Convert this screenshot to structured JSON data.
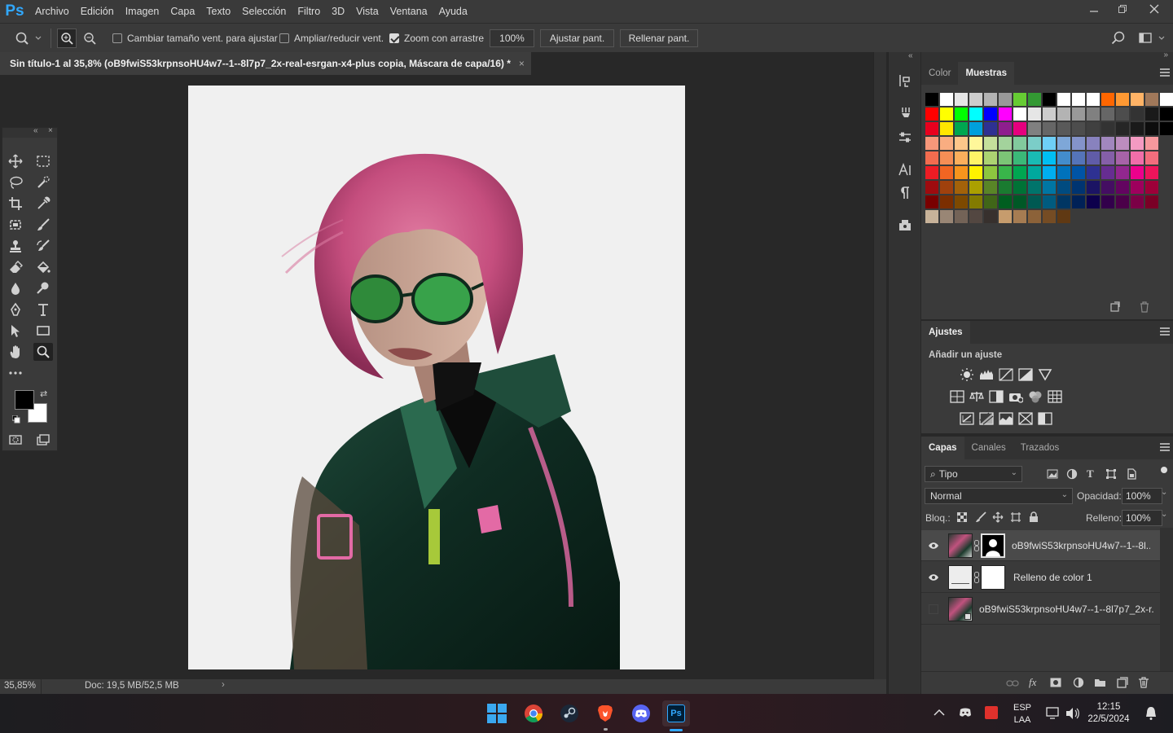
{
  "app": {
    "logo": "Ps"
  },
  "menu": [
    "Archivo",
    "Edición",
    "Imagen",
    "Capa",
    "Texto",
    "Selección",
    "Filtro",
    "3D",
    "Vista",
    "Ventana",
    "Ayuda"
  ],
  "window_controls": {
    "minimize": "minimize-icon",
    "restore": "restore-icon",
    "close": "close-icon"
  },
  "options": {
    "resize_label": "Cambiar tamaño vent. para ajustar",
    "resize_checked": false,
    "zoom_all_label": "Ampliar/reducir vent.",
    "zoom_all_checked": false,
    "scrubby_label": "Zoom con arrastre",
    "scrubby_checked": true,
    "zoom_value": "100%",
    "fit_label": "Ajustar pant.",
    "fill_label": "Rellenar pant."
  },
  "document": {
    "tab_title": "Sin título-1 al 35,8% (oB9fwiS53krpnsoHU4w7--1--8l7p7_2x-real-esrgan-x4-plus copia, Máscara de capa/16) *",
    "close_glyph": "×"
  },
  "status": {
    "zoom": "35,85%",
    "doc": "Doc: 19,5 MB/52,5 MB",
    "arrow": "›"
  },
  "panels": {
    "color_tabs": [
      "Color",
      "Muestras"
    ],
    "active_color_tab": "Muestras",
    "adjustments": {
      "title": "Ajustes",
      "subtitle": "Añadir un ajuste"
    },
    "layers_tabs": [
      "Capas",
      "Canales",
      "Trazados"
    ],
    "filter_kind": "Tipo",
    "blend_mode": "Normal",
    "opacity_label": "Opacidad:",
    "opacity_value": "100%",
    "lock_label": "Bloq.:",
    "fill_label": "Relleno:",
    "fill_value": "100%",
    "layers": [
      {
        "name": "oB9fwiS53krpnsoHU4w7--1--8l...",
        "visible": true,
        "selected": true,
        "has_mask": true
      },
      {
        "name": "Relleno de color 1",
        "visible": true,
        "selected": false,
        "has_mask": true
      },
      {
        "name": "oB9fwiS53krpnsoHU4w7--1--8l7p7_2x-r...",
        "visible": false,
        "selected": false,
        "has_mask": false
      }
    ]
  },
  "swatches": {
    "row1": [
      "#000000",
      "#ffffff",
      "#e6e6e6",
      "#cccccc",
      "#b3b3b3",
      "#999999",
      "#66cc33",
      "#339933",
      "#000000",
      "#ffffff",
      "#ffffff",
      "#ffffff",
      "#ff6600",
      "#ff9933",
      "#ffb366",
      "#a0785a",
      "#ffffff",
      "#ffffff"
    ],
    "grid_colors": "photoshop-default"
  },
  "taskbar": {
    "lang1": "ESP",
    "lang2": "LAA",
    "time": "12:15",
    "date": "22/5/2024"
  },
  "colors": {
    "accent": "#31a8ff",
    "panel_bg": "#3a3a3a",
    "canvas_bg": "#282828"
  }
}
